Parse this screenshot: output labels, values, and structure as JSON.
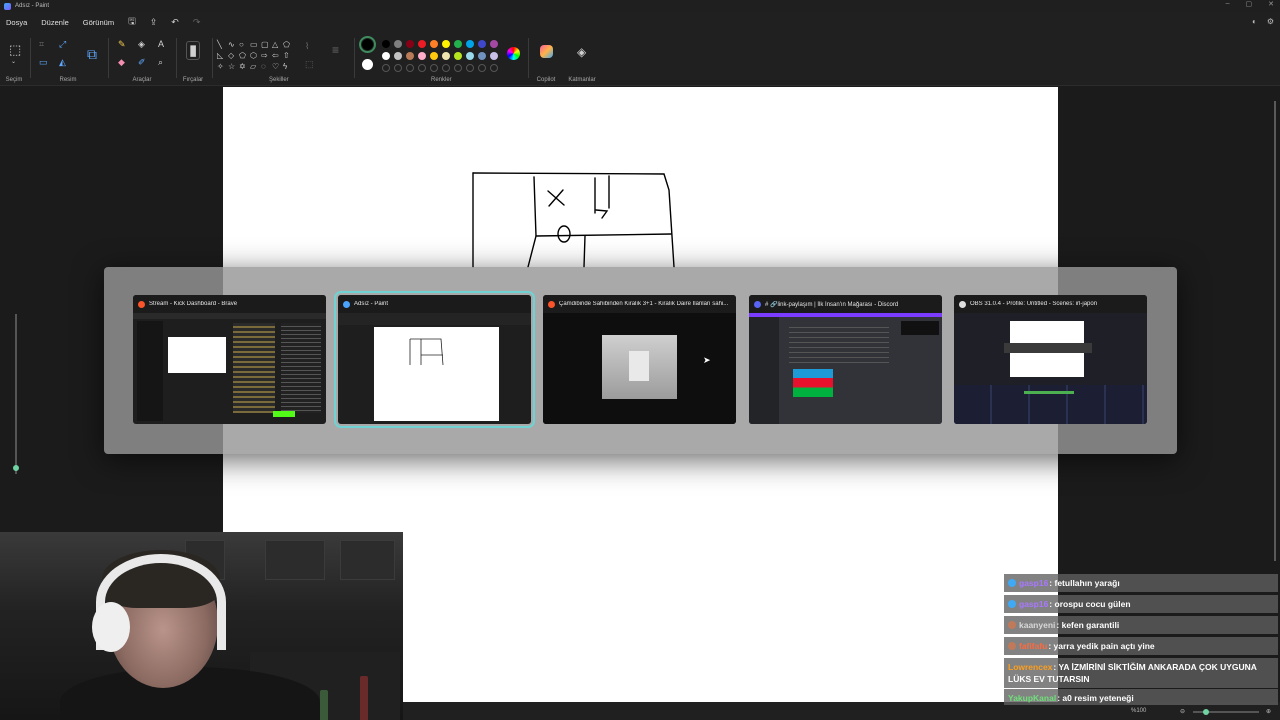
{
  "window": {
    "title": "Adsız - Paint"
  },
  "menu": {
    "items": [
      "Dosya",
      "Düzenle",
      "Görünüm"
    ]
  },
  "ribbon": {
    "groups": {
      "selection": "Seçim",
      "image": "Resim",
      "tools": "Araçlar",
      "brushes": "Fırçalar",
      "shapes": "Şekiller",
      "colors": "Renkler",
      "copilot": "Copilot",
      "layers": "Katmanlar"
    },
    "palette": [
      "#000000",
      "#7f7f7f",
      "#880015",
      "#ed1c24",
      "#ff7f27",
      "#fff200",
      "#22b14c",
      "#00a2e8",
      "#3f48cc",
      "#a349a4",
      "#ffffff",
      "#c3c3c3",
      "#b97a57",
      "#ffaec9",
      "#ffc90e",
      "#efe4b0",
      "#b5e61d",
      "#99d9ea",
      "#7092be",
      "#c8bfe7"
    ],
    "current_colors": [
      "#000000",
      "#ffffff"
    ]
  },
  "statusbar": {
    "zoom": "%100"
  },
  "switcher": {
    "windows": [
      {
        "title": "Stream - Kick Dashboard - Brave",
        "icon_color": "#fb542b",
        "active": false
      },
      {
        "title": "Adsız - Paint",
        "icon_color": "#4aa3ff",
        "active": true
      },
      {
        "title": "Çamdibinde Sahibinden Kiralık 3+1 - Kiralık Daire İlanları sahi...",
        "icon_color": "#fb542b",
        "active": false
      },
      {
        "title": "# 🔗link-paylaşım | İlk İnsan'ın Mağarası - Discord",
        "icon_color": "#5865f2",
        "active": false
      },
      {
        "title": "OBS 31.0.4 - Profile: Untitled - Scenes: irl-japon",
        "icon_color": "#dddddd",
        "active": false
      }
    ]
  },
  "chat": {
    "messages": [
      {
        "user": "gasp16",
        "user_color": "#a978ff",
        "text": "fetullahın yarağı"
      },
      {
        "user": "gasp16",
        "user_color": "#a978ff",
        "text": "orospu cocu gülen"
      },
      {
        "user": "kaanyeni",
        "user_color": "#d8d8d8",
        "text": "kefen garantili"
      },
      {
        "user": "fafifafu",
        "user_color": "#ff6a3d",
        "text": "yarra yedik pain açtı yine"
      },
      {
        "user": "Lowrencex",
        "user_color": "#ff9f1a",
        "text": "YA İZMİRİNİ SİKTİĞİM ANKARADA ÇOK UYGUNA LÜKS EV TUTARSIN"
      },
      {
        "user": "YakupKanal",
        "user_color": "#6fe07a",
        "text": "a0 resim yeteneği"
      }
    ]
  }
}
